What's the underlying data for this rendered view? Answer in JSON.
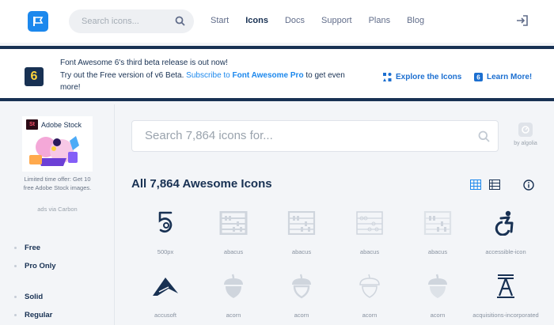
{
  "nav": {
    "search_placeholder": "Search icons...",
    "links": [
      "Start",
      "Icons",
      "Docs",
      "Support",
      "Plans",
      "Blog"
    ],
    "active": "Icons"
  },
  "banner": {
    "badge": "6",
    "line1": "Font Awesome 6's third beta release is out now!",
    "line2_pre": "Try out the Free version of v6 Beta. ",
    "line2_link": "Subscribe to ",
    "line2_link_bold": "Font Awesome Pro",
    "line2_post": " to get even more!",
    "action1": "Explore the Icons",
    "action2": "Learn More!"
  },
  "sidebar": {
    "ad_brand": "Adobe Stock",
    "ad_logo": "St",
    "ad_text": "Limited time offer: Get 10 free Adobe Stock images.",
    "ad_via": "ads via Carbon",
    "filters": [
      "Free",
      "Pro Only",
      "Solid",
      "Regular"
    ]
  },
  "main": {
    "search_placeholder": "Search 7,864 icons for...",
    "algolia": "by algolia",
    "heading": "All 7,864 Awesome Icons",
    "icons": [
      {
        "label": "500px",
        "icon": "500px-icon"
      },
      {
        "label": "abacus",
        "icon": "abacus-icon"
      },
      {
        "label": "abacus",
        "icon": "abacus-icon"
      },
      {
        "label": "abacus",
        "icon": "abacus-icon"
      },
      {
        "label": "abacus",
        "icon": "abacus-icon"
      },
      {
        "label": "accessible-icon",
        "icon": "accessible-icon"
      },
      {
        "label": "accusoft",
        "icon": "accusoft-icon"
      },
      {
        "label": "acorn",
        "icon": "acorn-icon"
      },
      {
        "label": "acorn",
        "icon": "acorn-icon"
      },
      {
        "label": "acorn",
        "icon": "acorn-icon"
      },
      {
        "label": "acorn",
        "icon": "acorn-icon"
      },
      {
        "label": "acquisitions-incorporated",
        "icon": "acquisitions-incorporated-icon"
      }
    ]
  },
  "colors": {
    "navy": "#183153",
    "blue": "#1c88ed",
    "background": "#f3f5f8",
    "pro_icon": "#cfd5dd"
  }
}
